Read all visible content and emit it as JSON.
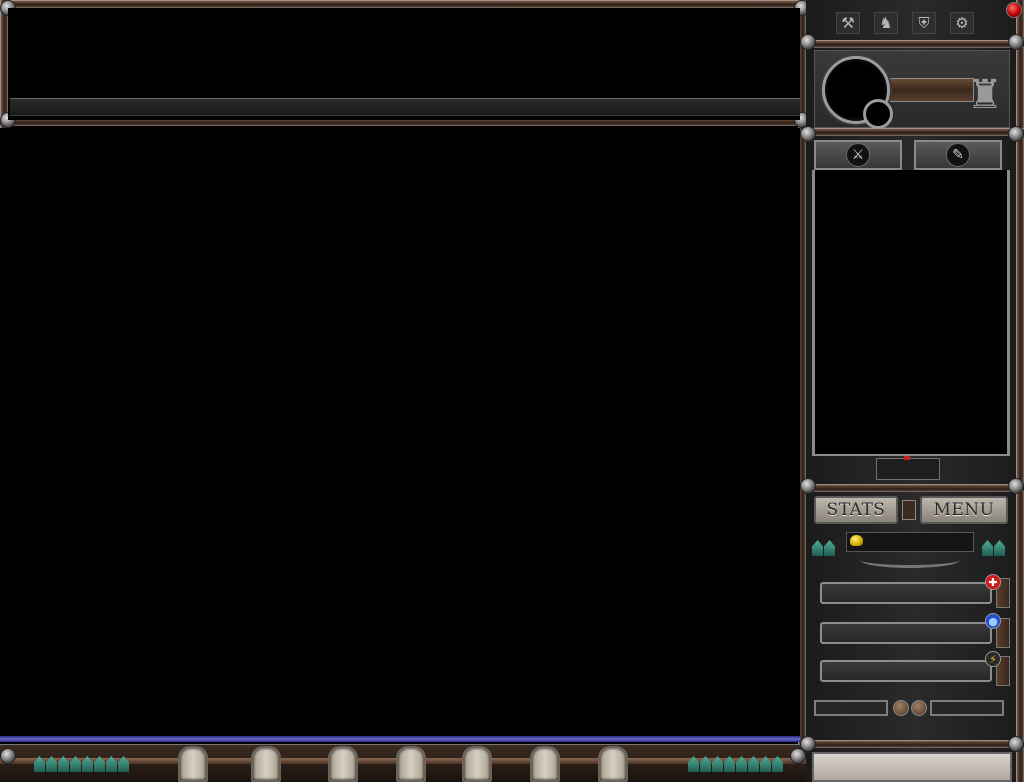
{
  "window": {
    "close_icon": "close-orb-icon"
  },
  "top_tabs": [
    {
      "name": "skills-tab",
      "icon": "crossed-tools-icon",
      "glyph": "⚒"
    },
    {
      "name": "character-tab",
      "icon": "knight-helmet-icon",
      "glyph": "♞"
    },
    {
      "name": "equipment-tab",
      "icon": "armor-icon",
      "glyph": "⛨"
    },
    {
      "name": "options-tab",
      "icon": "gear-icon",
      "glyph": "⚙"
    }
  ],
  "inventory_tabs": [
    {
      "name": "weapons-tab",
      "icon": "axe-icon",
      "glyph": "⚔"
    },
    {
      "name": "scrolls-tab",
      "icon": "scroll-icon",
      "glyph": "✎"
    }
  ],
  "buttons": {
    "stats_label": "STATS",
    "menu_label": "MENU"
  },
  "gold": {
    "icon": "gold-coins-icon",
    "value": ""
  },
  "vitals": [
    {
      "name": "health",
      "icon": "health-cross-icon",
      "glyph": "✚",
      "color": "#d01818",
      "fraction": 0
    },
    {
      "name": "mana",
      "icon": "mana-orb-icon",
      "glyph": "●",
      "color": "#2050d0",
      "fraction": 0
    },
    {
      "name": "stamina",
      "icon": "energy-bolt-icon",
      "glyph": "⚡",
      "color": "#d0a010",
      "fraction": 0
    }
  ],
  "quick_slots": 7,
  "colors": {
    "accent_blue": "#6a6ac8",
    "tooth_green": "#4fae9b",
    "frame_brown": "#4a3427"
  }
}
